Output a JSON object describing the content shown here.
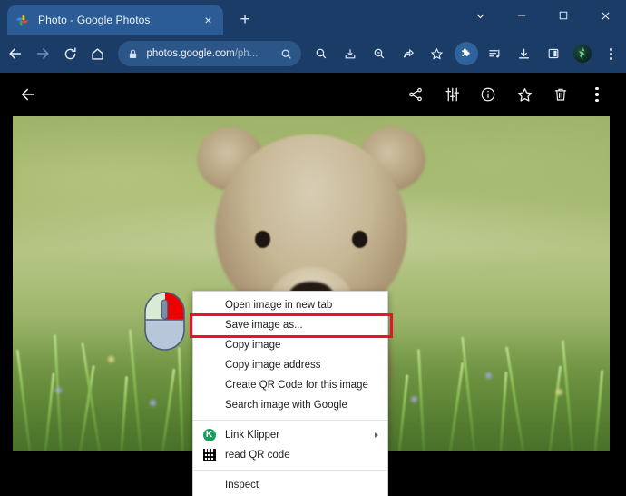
{
  "window": {
    "controls": [
      {
        "name": "tab-search",
        "label": "Search tabs"
      },
      {
        "name": "minimize",
        "label": "Minimize"
      },
      {
        "name": "maximize",
        "label": "Maximize"
      },
      {
        "name": "close",
        "label": "Close"
      }
    ]
  },
  "tab_strip": {
    "tab": {
      "title": "Photo - Google Photos",
      "favicon": "google-photos-icon",
      "close_label": "×"
    },
    "new_tab_label": "+"
  },
  "toolbar": {
    "back_label": "←",
    "forward_label": "→",
    "reload_label": "⟳",
    "home_label": "⌂",
    "omnibox": {
      "url_main": "photos.google.com",
      "url_path": "/ph...",
      "lock_icon": "lock-icon",
      "search_icon": "search-icon"
    },
    "icons": [
      {
        "name": "omnibox-search-icon",
        "title": "Search"
      },
      {
        "name": "install-app-icon",
        "title": "Install"
      },
      {
        "name": "zoom-out-icon",
        "title": "Zoom"
      },
      {
        "name": "share-icon",
        "title": "Share this page"
      },
      {
        "name": "bookmark-star-icon",
        "title": "Bookmark"
      },
      {
        "name": "extensions-puzzle-icon",
        "title": "Extensions"
      },
      {
        "name": "media-playlist-icon",
        "title": "Media"
      },
      {
        "name": "downloads-icon",
        "title": "Downloads"
      },
      {
        "name": "side-panel-icon",
        "title": "Side panel"
      },
      {
        "name": "profile-avatar",
        "title": "Profile"
      },
      {
        "name": "chrome-menu-icon",
        "title": "Customize and control"
      }
    ]
  },
  "photos_app": {
    "back_label": "←",
    "actions": [
      {
        "name": "share-icon",
        "title": "Share"
      },
      {
        "name": "edit-sliders-icon",
        "title": "Edit"
      },
      {
        "name": "info-icon",
        "title": "Info"
      },
      {
        "name": "favorite-star-icon",
        "title": "Favorite"
      },
      {
        "name": "delete-trash-icon",
        "title": "Delete"
      },
      {
        "name": "more-options-icon",
        "title": "More options"
      }
    ],
    "photo_alt": "Brown bear cub in green meadow grass"
  },
  "context_menu": {
    "items": [
      {
        "label": "Open image in new tab",
        "icon": null,
        "submenu": false,
        "separator_after": false
      },
      {
        "label": "Save image as...",
        "icon": null,
        "submenu": false,
        "separator_after": false,
        "highlighted": true
      },
      {
        "label": "Copy image",
        "icon": null,
        "submenu": false,
        "separator_after": false
      },
      {
        "label": "Copy image address",
        "icon": null,
        "submenu": false,
        "separator_after": false
      },
      {
        "label": "Create QR Code for this image",
        "icon": null,
        "submenu": false,
        "separator_after": false
      },
      {
        "label": "Search image with Google",
        "icon": null,
        "submenu": false,
        "separator_after": true
      },
      {
        "label": "Link Klipper",
        "icon": "link-klipper-icon",
        "submenu": true,
        "separator_after": false
      },
      {
        "label": "read QR code",
        "icon": "qr-code-icon",
        "submenu": false,
        "separator_after": true
      },
      {
        "label": "Inspect",
        "icon": null,
        "submenu": false,
        "separator_after": false
      }
    ]
  },
  "annotation": {
    "highlight_color": "#e8132a",
    "mouse_icon": "right-click-mouse-icon",
    "mouse_highlight_color": "#ef0000"
  },
  "colors": {
    "tab_strip_bg": "#1b3c67",
    "active_tab_bg": "#2b5c95",
    "omnibox_bg": "#2c5688",
    "page_bg": "#000000",
    "menu_bg": "#ffffff",
    "menu_text": "#202124"
  }
}
